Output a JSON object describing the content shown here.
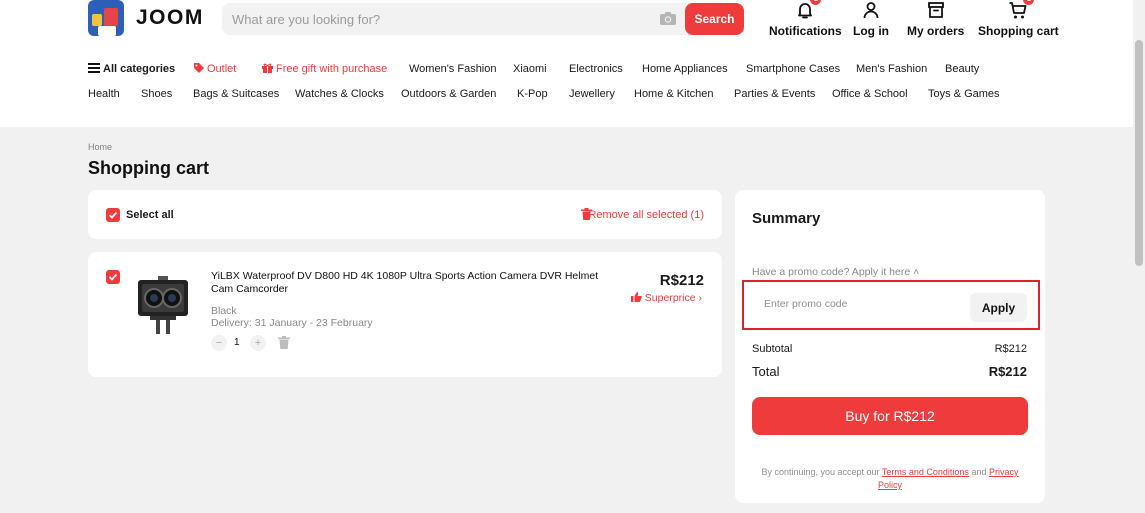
{
  "header": {
    "brand": "JOOM",
    "search_placeholder": "What are you looking for?",
    "search_button": "Search",
    "actions": {
      "notifications": {
        "label": "Notifications",
        "badge": "1"
      },
      "login": {
        "label": "Log in"
      },
      "orders": {
        "label": "My orders"
      },
      "cart": {
        "label": "Shopping cart",
        "badge": "1"
      }
    }
  },
  "categories": {
    "row1": [
      "All categories",
      "Outlet",
      "Free gift with purchase",
      "Women's Fashion",
      "Xiaomi",
      "Electronics",
      "Home Appliances",
      "Smartphone Cases",
      "Men's Fashion",
      "Beauty"
    ],
    "row2": [
      "Health",
      "Shoes",
      "Bags & Suitcases",
      "Watches & Clocks",
      "Outdoors & Garden",
      "K-Pop",
      "Jewellery",
      "Home & Kitchen",
      "Parties & Events",
      "Office & School",
      "Toys & Games"
    ]
  },
  "breadcrumb": "Home",
  "page_title": "Shopping cart",
  "cart": {
    "select_all": "Select all",
    "remove_selected": "Remove all selected (1)",
    "item": {
      "title": "YiLBX Waterproof DV D800 HD 4K 1080P Ultra Sports Action Camera DVR Helmet Cam Camcorder",
      "variant": "Black",
      "delivery": "Delivery: 31 January - 23 February",
      "price": "R$212",
      "superprice": "Superprice",
      "quantity": "1"
    }
  },
  "summary": {
    "title": "Summary",
    "promo_question": "Have a promo code? Apply it here",
    "promo_placeholder": "Enter promo code",
    "apply_button": "Apply",
    "subtotal_label": "Subtotal",
    "subtotal_value": "R$212",
    "total_label": "Total",
    "total_value": "R$212",
    "buy_button": "Buy for R$212",
    "terms_prefix": "By continuing, you accept our",
    "terms_link": "Terms and Conditions",
    "terms_and": "and",
    "privacy_link": "Privacy Policy"
  },
  "colors": {
    "accent": "#ef3b3b",
    "highlight_border": "#d9232e",
    "background": "#f1f1f1"
  }
}
